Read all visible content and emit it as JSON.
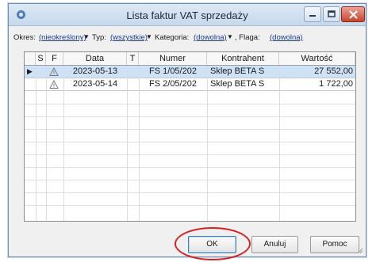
{
  "window": {
    "title": "Lista faktur VAT sprzedaży",
    "icons": {
      "app": "app-icon",
      "minimize": "minimize-icon",
      "maximize": "maximize-icon",
      "close": "close-icon"
    }
  },
  "filters": {
    "okres_label": "Okres:",
    "okres_value": "(nieokreślony)",
    "typ_label": "Typ:",
    "typ_value": "(wszystkie)",
    "kategoria_label": "Kategoria:",
    "kategoria_value": "(dowolna)",
    "flaga_label": ", Flaga:",
    "flaga_value": "(dowolna)",
    "caret": "▼"
  },
  "grid": {
    "columns": [
      "S",
      "F",
      "Data",
      "T",
      "Numer",
      "Kontrahent",
      "Wartość"
    ],
    "rows": [
      {
        "indicator": "▶",
        "status_icon": "warning-icon",
        "data": "2023-05-13",
        "numer": "FS 1/05/202",
        "kontrahent": "Sklep BETA S",
        "wartosc": "27 552,00",
        "selected": true
      },
      {
        "indicator": "",
        "status_icon": "warning-icon",
        "data": "2023-05-14",
        "numer": "FS 2/05/202",
        "kontrahent": "Sklep BETA S",
        "wartosc": "1 722,00",
        "selected": false
      }
    ]
  },
  "buttons": {
    "ok": "OK",
    "cancel": "Anuluj",
    "help": "Pomoc"
  },
  "colors": {
    "annotation": "#d62020",
    "selected_row": "#cde2f7",
    "close_button": "#c8432b"
  }
}
